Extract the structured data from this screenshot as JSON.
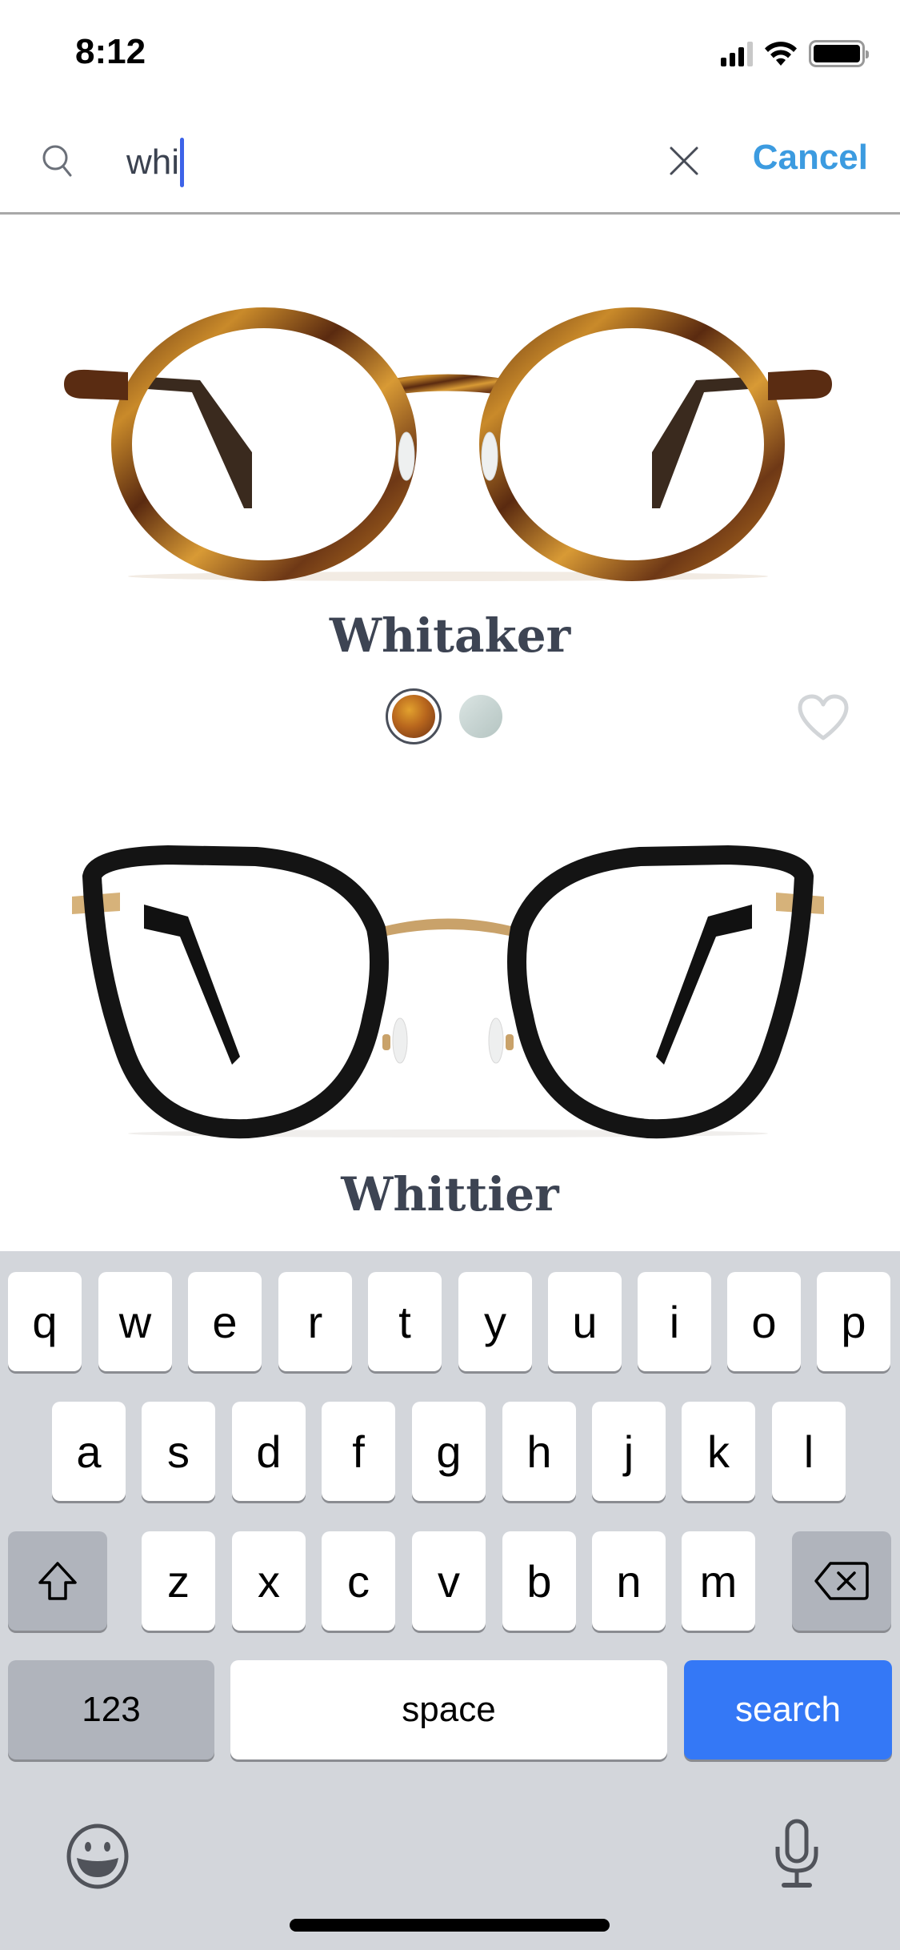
{
  "status_bar": {
    "time": "8:12",
    "icons": [
      "cellular-signal-icon",
      "wifi-icon",
      "battery-icon"
    ]
  },
  "search": {
    "query": "whi",
    "icon": "search-icon",
    "clear_icon": "clear-icon",
    "cancel_label": "Cancel",
    "accent_color": "#3c9be0",
    "caret_color": "#3d63e8"
  },
  "products": [
    {
      "name": "Whitaker",
      "frame": "tortoise acetate round frame with gold temples",
      "swatches": [
        {
          "name": "tortoise",
          "selected": true,
          "color": "#b8661d"
        },
        {
          "name": "clear-crystal",
          "selected": false,
          "color": "#c7d4d2"
        }
      ],
      "favorite": false
    },
    {
      "name": "Whittier",
      "frame": "black acetate round frame with gold bridge"
    }
  ],
  "keyboard": {
    "row1": [
      "q",
      "w",
      "e",
      "r",
      "t",
      "y",
      "u",
      "i",
      "o",
      "p"
    ],
    "row2": [
      "a",
      "s",
      "d",
      "f",
      "g",
      "h",
      "j",
      "k",
      "l"
    ],
    "row3": [
      "z",
      "x",
      "c",
      "v",
      "b",
      "n",
      "m"
    ],
    "shift_icon": "shift-icon",
    "delete_icon": "delete-icon",
    "numbers_label": "123",
    "space_label": "space",
    "return_label": "search",
    "return_color": "#3478f6",
    "emoji_icon": "emoji-icon",
    "mic_icon": "microphone-icon"
  }
}
